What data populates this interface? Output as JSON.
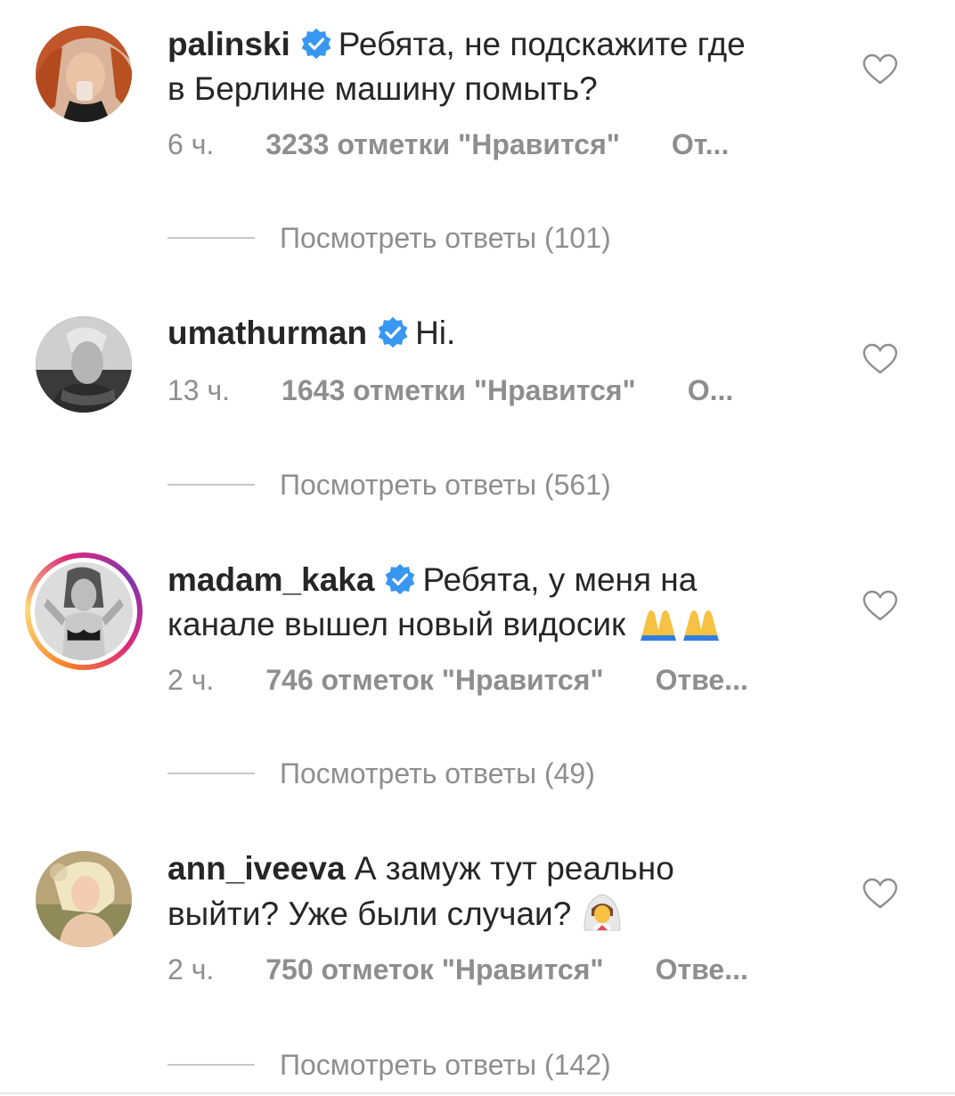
{
  "comments": [
    {
      "username": "palinski",
      "verified": true,
      "text_line1": "Ребята, не подскажите где",
      "text_line2": "в Берлине машину помыть?",
      "time": "6 ч.",
      "likes": "3233 отметки \"Нравится\"",
      "reply": "От...",
      "view_replies": "Посмотреть ответы (101)"
    },
    {
      "username": "umathurman",
      "verified": true,
      "text_line1": "Hi.",
      "time": "13 ч.",
      "likes": "1643 отметки \"Нравится\"",
      "reply": "О...",
      "view_replies": "Посмотреть ответы (561)"
    },
    {
      "username": "madam_kaka",
      "verified": true,
      "has_story": true,
      "text_line1": "Ребята, у меня на",
      "text_line2": "канале вышел новый видосик",
      "emoji": "praying-hands-emoji",
      "time": "2 ч.",
      "likes": "746 отметок \"Нравится\"",
      "reply": "Отве...",
      "view_replies": "Посмотреть ответы (49)"
    },
    {
      "username": "ann_iveeva",
      "verified": false,
      "text_line1": "А замуж тут реально",
      "text_line2": "выйти? Уже были случаи?",
      "emoji": "bride-emoji",
      "time": "2 ч.",
      "likes": "750 отметок \"Нравится\"",
      "reply": "Отве...",
      "view_replies": "Посмотреть ответы (142)"
    }
  ],
  "colors": {
    "text": "#262626",
    "secondary": "#8e8e8e",
    "verified": "#3897f0"
  }
}
